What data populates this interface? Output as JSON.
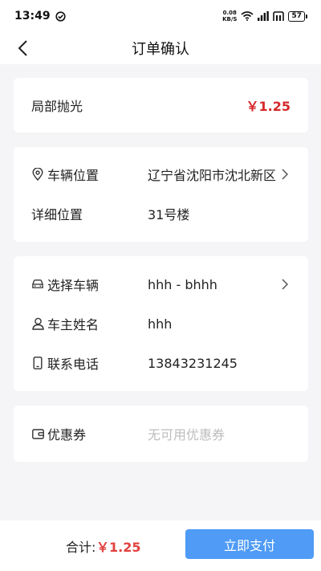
{
  "status_bar": {
    "time": "13:49",
    "net_speed_value": "0.08",
    "net_speed_unit": "KB/S",
    "battery": "57",
    "icons": [
      "check-circle-icon",
      "wifi-icon",
      "signal-icon",
      "hd-icon",
      "battery-icon"
    ]
  },
  "header": {
    "title": "订单确认",
    "back_icon": "chevron-left-icon"
  },
  "service": {
    "name": "局部抛光",
    "price": "￥1.25"
  },
  "location": {
    "vehicle_location_label": "车辆位置",
    "vehicle_location_value": "辽宁省沈阳市沈北新区",
    "detail_label": "详细位置",
    "detail_value": "31号楼"
  },
  "vehicle": {
    "select_label": "选择车辆",
    "select_value": "hhh - bhhh",
    "owner_label": "车主姓名",
    "owner_value": "hhh",
    "phone_label": "联系电话",
    "phone_value": "13843231245"
  },
  "coupon": {
    "label": "优惠券",
    "value": "无可用优惠券"
  },
  "footer": {
    "total_label": "合计:",
    "total_price": "￥1.25",
    "pay_button": "立即支付"
  },
  "colors": {
    "accent": "#4f9bf5",
    "price_red": "#d6282b",
    "background": "#f5f5f7"
  }
}
